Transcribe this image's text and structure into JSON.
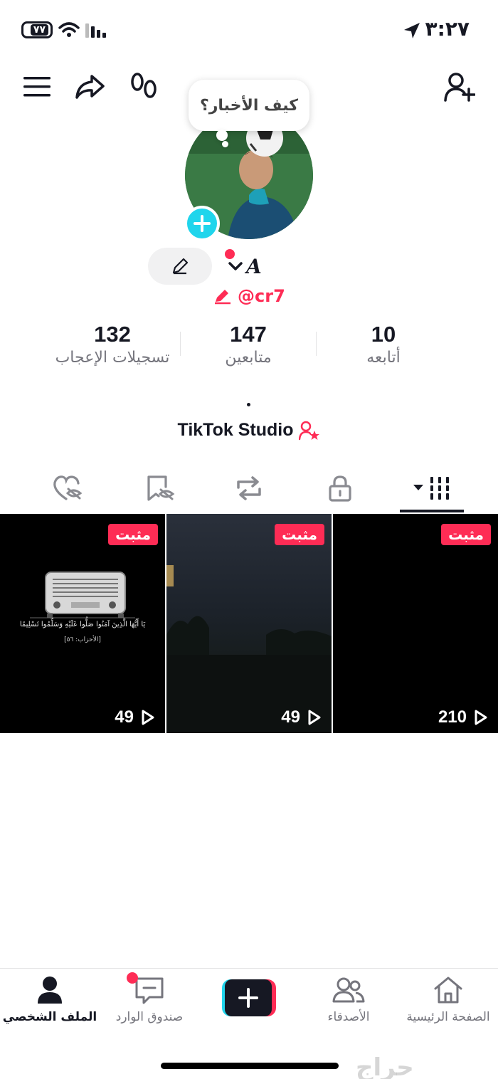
{
  "status_bar": {
    "time": "٣:٢٧",
    "battery": "٧٧"
  },
  "bubble_text": "كيف الأخبار؟",
  "profile": {
    "name": "A",
    "handle": "@cr7"
  },
  "stats": [
    {
      "value": "132",
      "label": "تسجيلات الإعجاب"
    },
    {
      "value": "147",
      "label": "متابعين"
    },
    {
      "value": "10",
      "label": "أتابعه"
    }
  ],
  "bio_dot": "•",
  "studio_label": "TikTok Studio",
  "videos": [
    {
      "pinned": "مثبت",
      "views": "49",
      "caption": "يَا أَيُّهَا الَّذِينَ آمَنُوا صَلُّوا عَلَيْهِ وَسَلِّمُوا تَسْلِيمًا",
      "source": "[الأحزاب: ٥٦]"
    },
    {
      "pinned": "مثبت",
      "views": "49"
    },
    {
      "pinned": "مثبت",
      "views": "210"
    }
  ],
  "nav": {
    "profile": "الملف الشخصي",
    "inbox": "صندوق الوارد",
    "friends": "الأصدقاء",
    "home": "الصفحة الرئيسية"
  },
  "watermark": "حراج",
  "colors": {
    "accent": "#fe2c55",
    "cyan": "#20d5ec",
    "text": "#161823",
    "muted": "#75757d"
  }
}
